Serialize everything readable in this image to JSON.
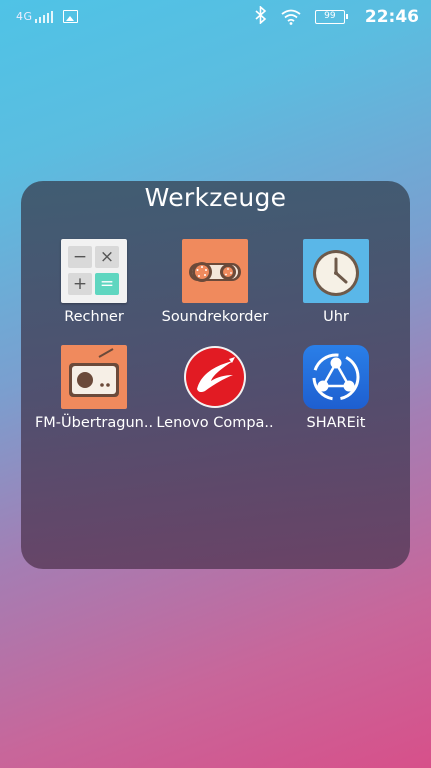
{
  "statusbar": {
    "network": "4G",
    "battery": "99",
    "time": "22:46"
  },
  "folder": {
    "title": "Werkzeuge",
    "apps": [
      {
        "label": "Rechner",
        "icon": "calculator-icon"
      },
      {
        "label": "Soundrekorder",
        "icon": "sound-recorder-icon"
      },
      {
        "label": "Uhr",
        "icon": "clock-icon"
      },
      {
        "label": "FM-Übertragun..",
        "icon": "fm-radio-icon"
      },
      {
        "label": "Lenovo Compa..",
        "icon": "lenovo-companion-icon"
      },
      {
        "label": "SHAREit",
        "icon": "shareit-icon"
      }
    ]
  },
  "colors": {
    "accent_orange": "#f08a5d",
    "clock_blue": "#5ab7e8",
    "lenovo_red": "#e21b23",
    "shareit_blue": "#2a7fe8",
    "calc_teal": "#5fd6c0"
  }
}
